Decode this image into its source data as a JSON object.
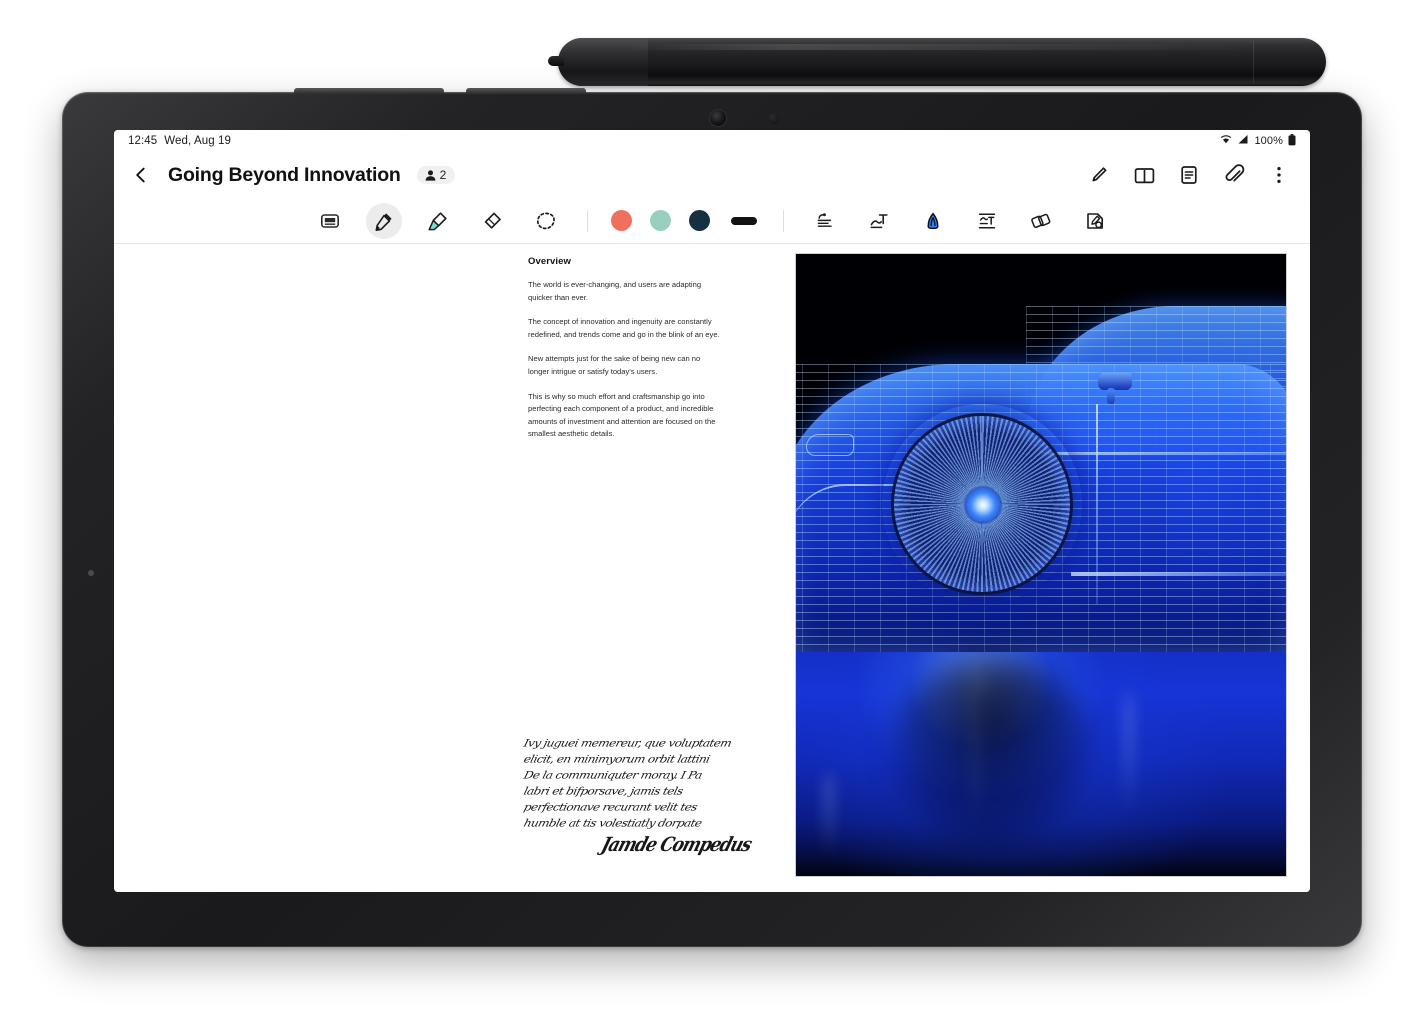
{
  "device": {
    "name": "tablet",
    "stylus_label": "s-pen-stylus",
    "frame_color": "#1a1a1c"
  },
  "status_bar": {
    "time": "12:45",
    "date": "Wed, Aug 19",
    "wifi_icon": "wifi-icon",
    "signal_icon": "cellular-signal-icon",
    "battery_percent": "100%",
    "battery_icon": "battery-full-icon"
  },
  "app_bar": {
    "back_icon": "chevron-left-icon",
    "title": "Going Beyond Innovation",
    "collaborators": {
      "icon": "person-icon",
      "count": "2"
    },
    "actions": [
      {
        "name": "pen-select-mode",
        "icon": "pen-cursor-icon"
      },
      {
        "name": "reading-mode",
        "icon": "book-icon"
      },
      {
        "name": "note-list",
        "icon": "document-list-icon"
      },
      {
        "name": "attachments",
        "icon": "paperclip-icon"
      },
      {
        "name": "more-options",
        "icon": "more-vertical-icon"
      }
    ]
  },
  "toolbar": {
    "tools": [
      {
        "name": "text-box-tool",
        "icon": "text-box-icon",
        "selected": false
      },
      {
        "name": "pen-tool",
        "icon": "pen-icon",
        "selected": true
      },
      {
        "name": "highlighter-tool",
        "icon": "highlighter-icon",
        "selected": false
      },
      {
        "name": "eraser-tool",
        "icon": "eraser-icon",
        "selected": false
      },
      {
        "name": "lasso-select-tool",
        "icon": "lasso-select-icon",
        "selected": false
      }
    ],
    "colors": [
      {
        "name": "color-swatch-coral",
        "hex": "#F0705E"
      },
      {
        "name": "color-swatch-mint",
        "hex": "#9ACFC0"
      },
      {
        "name": "color-swatch-navy",
        "hex": "#143041"
      }
    ],
    "stroke": {
      "name": "stroke-width-pill",
      "hex": "#131313"
    },
    "right_tools": [
      {
        "name": "paragraph-align-tool",
        "icon": "text-align-icon"
      },
      {
        "name": "handwriting-to-text-tool",
        "icon": "convert-to-text-icon"
      },
      {
        "name": "shape-recognition-tool",
        "icon": "auto-shape-icon",
        "accent": "#2B7FFF"
      },
      {
        "name": "insert-text-tool",
        "icon": "insert-text-icon"
      },
      {
        "name": "straighten-tool",
        "icon": "shape-pair-icon"
      },
      {
        "name": "pen-settings-tool",
        "icon": "pen-settings-icon"
      }
    ]
  },
  "note": {
    "heading": "Overview",
    "paragraphs": [
      "The world is ever-changing, and users are adapting quicker than ever.",
      "The concept of innovation and ingenuity are constantly redefined, and trends come and go in the blink of an eye.",
      "New attempts just for the sake of being new can no longer intrigue or satisfy today's users.",
      "This is why so much effort and craftsmanship go into perfecting each component of a product, and incredible amounts of investment and attention are focused on the smallest aesthetic details."
    ],
    "handwriting": {
      "name": "handwritten-signature-block",
      "lines": [
        "Ivy juguei memereur, que voluptatem",
        "elicit, en minimyorum orbit lattini",
        "De la communiquter moray. I Pa",
        "labri et bifporsave, jamis tels",
        "perfectionave recurant velit tes",
        "humble at tis volestiatly dorpate",
        "Jamde Compedus"
      ]
    },
    "image": {
      "name": "wireframe-sports-car-image",
      "description": "Blue wireframe sports car on black background with blue reflection",
      "accent": "#1E5AFF"
    }
  }
}
